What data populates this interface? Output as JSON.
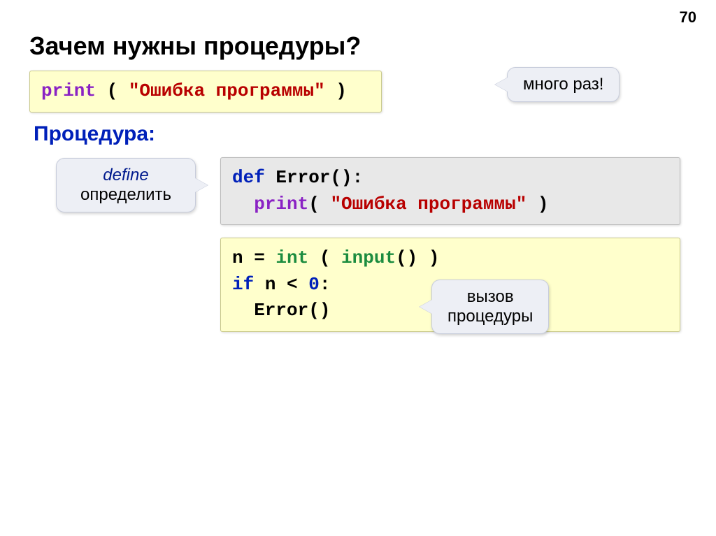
{
  "pageNumber": "70",
  "title": "Зачем нужны процедуры?",
  "box1": {
    "print": "print",
    "open": " ( ",
    "str": "\"Ошибка программы\"",
    "close": " )"
  },
  "bubble1": "много раз!",
  "subheading": "Процедура:",
  "bubble2": {
    "top": "define",
    "bottom": "определить"
  },
  "box2": {
    "def": "def",
    "name": " Error():",
    "indent": "  ",
    "print": "print",
    "open": "( ",
    "str": "\"Ошибка программы\"",
    "close": " )"
  },
  "box3": {
    "line1_a": "n = ",
    "line1_int": "int",
    "line1_mid": " ( ",
    "line1_input": "input",
    "line1_end": "() )",
    "line2_if": "if",
    "line2_cond": " n < ",
    "line2_zero": "0",
    "line2_colon": ":",
    "line3_indent": "  ",
    "line3_call": "Error()"
  },
  "bubble3": {
    "top": "вызов",
    "bottom": "процедуры"
  }
}
